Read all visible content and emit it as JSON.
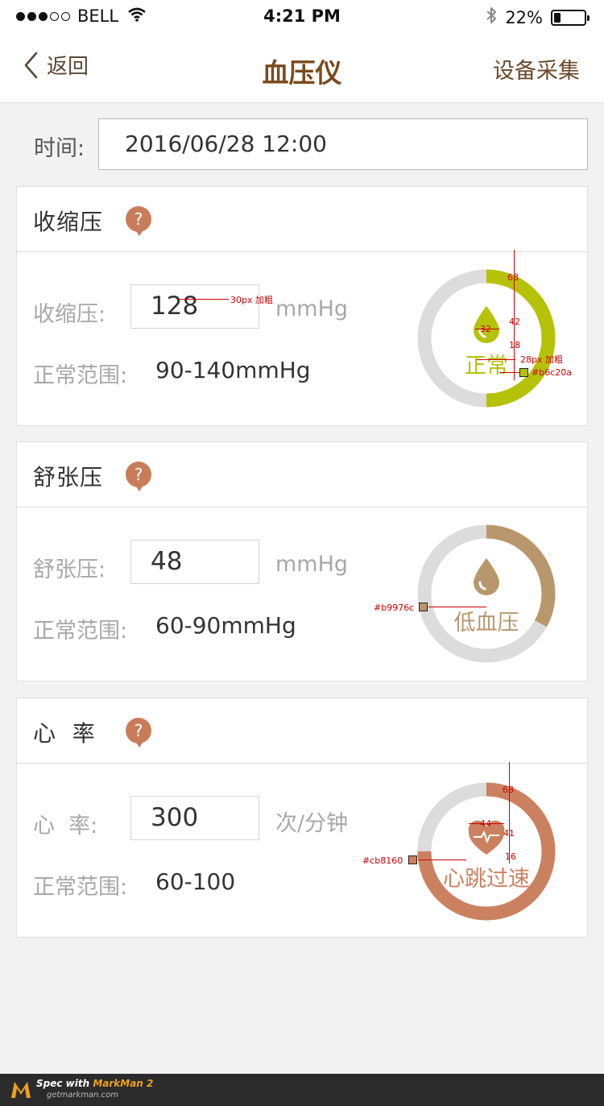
{
  "status_bar": {
    "carrier": "BELL",
    "time": "4:21 PM",
    "battery_percent": "22%",
    "battery_level": 0.22
  },
  "nav": {
    "back_label": "返回",
    "title": "血压仪",
    "right_action": "设备采集"
  },
  "time_row": {
    "label": "时间:",
    "value": "2016/06/28 12:00"
  },
  "cards": [
    {
      "title": "收缩压",
      "field_label": "收缩压:",
      "value": "128",
      "unit": "mmHg",
      "range_label": "正常范围:",
      "range_value": "90-140mmHg",
      "status": "正常",
      "color": "#b6c20a",
      "progress": 0.5,
      "icon": "drop-icon"
    },
    {
      "title": "舒张压",
      "field_label": "舒张压:",
      "value": "48",
      "unit": "mmHg",
      "range_label": "正常范围:",
      "range_value": "60-90mmHg",
      "status": "低血压",
      "color": "#b9976c",
      "progress": 0.33,
      "icon": "drop-icon"
    },
    {
      "title": "心  率",
      "field_label": "心  率:",
      "value": "300",
      "unit": "次/分钟",
      "range_label": "正常范围:",
      "range_value": "60-100",
      "status": "心跳过速",
      "color": "#cb8160",
      "progress": 0.75,
      "icon": "heart-icon"
    }
  ],
  "spec_notes": {
    "font1": "30px 加粗",
    "font2": "28px 加粗",
    "color1": "#b6c20a",
    "color2": "#b9976c",
    "color3": "#cb8160",
    "m68a": "68",
    "m42": "42",
    "m18": "18",
    "m32": "32",
    "m68b": "68",
    "m41": "41",
    "m16": "16",
    "m44": "44"
  },
  "footer": {
    "spec_with": "Spec with ",
    "brand": "MarkMan 2",
    "url": "getmarkman.com"
  }
}
